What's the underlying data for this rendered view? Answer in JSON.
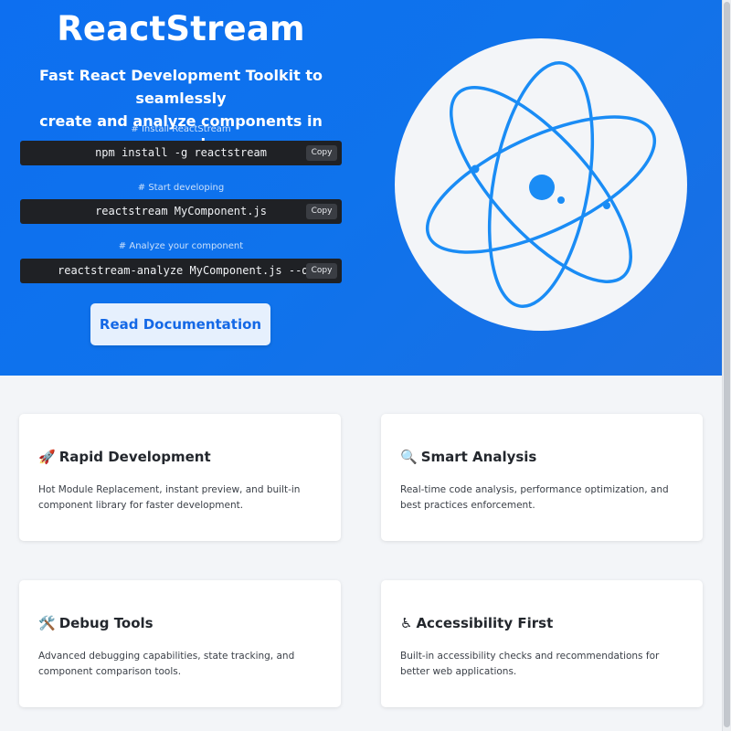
{
  "hero": {
    "title": "ReactStream",
    "tagline_line1": "Fast React Development Toolkit to seamlessly",
    "tagline_line2": "create and analyze components in seconds",
    "commands": [
      {
        "caption": "# Install ReactStream",
        "command": "npm install -g reactstream",
        "copy_label": "Copy"
      },
      {
        "caption": "# Start developing",
        "command": "reactstream MyComponent.js",
        "copy_label": "Copy"
      },
      {
        "caption": "# Analyze your component",
        "command": "reactstream-analyze MyComponent.js --debug",
        "copy_label": "Copy"
      }
    ],
    "docs_button": "Read Documentation",
    "logo_icon": "atom-logo-icon"
  },
  "features": [
    {
      "icon": "🚀",
      "title": "Rapid Development",
      "description": "Hot Module Replacement, instant preview, and built-in component library for faster development."
    },
    {
      "icon": "🔍",
      "title": "Smart Analysis",
      "description": "Real-time code analysis, performance optimization, and best practices enforcement."
    },
    {
      "icon": "🛠️",
      "title": "Debug Tools",
      "description": "Advanced debugging capabilities, state tracking, and component comparison tools."
    },
    {
      "icon": "♿",
      "title": "Accessibility First",
      "description": "Built-in accessibility checks and recommendations for better web applications."
    }
  ],
  "colors": {
    "hero_gradient_start": "#0d6ff0",
    "hero_gradient_end": "#1a6fe3",
    "accent": "#1468e6",
    "code_bg": "#1f2125",
    "page_bg": "#f3f5f8"
  }
}
